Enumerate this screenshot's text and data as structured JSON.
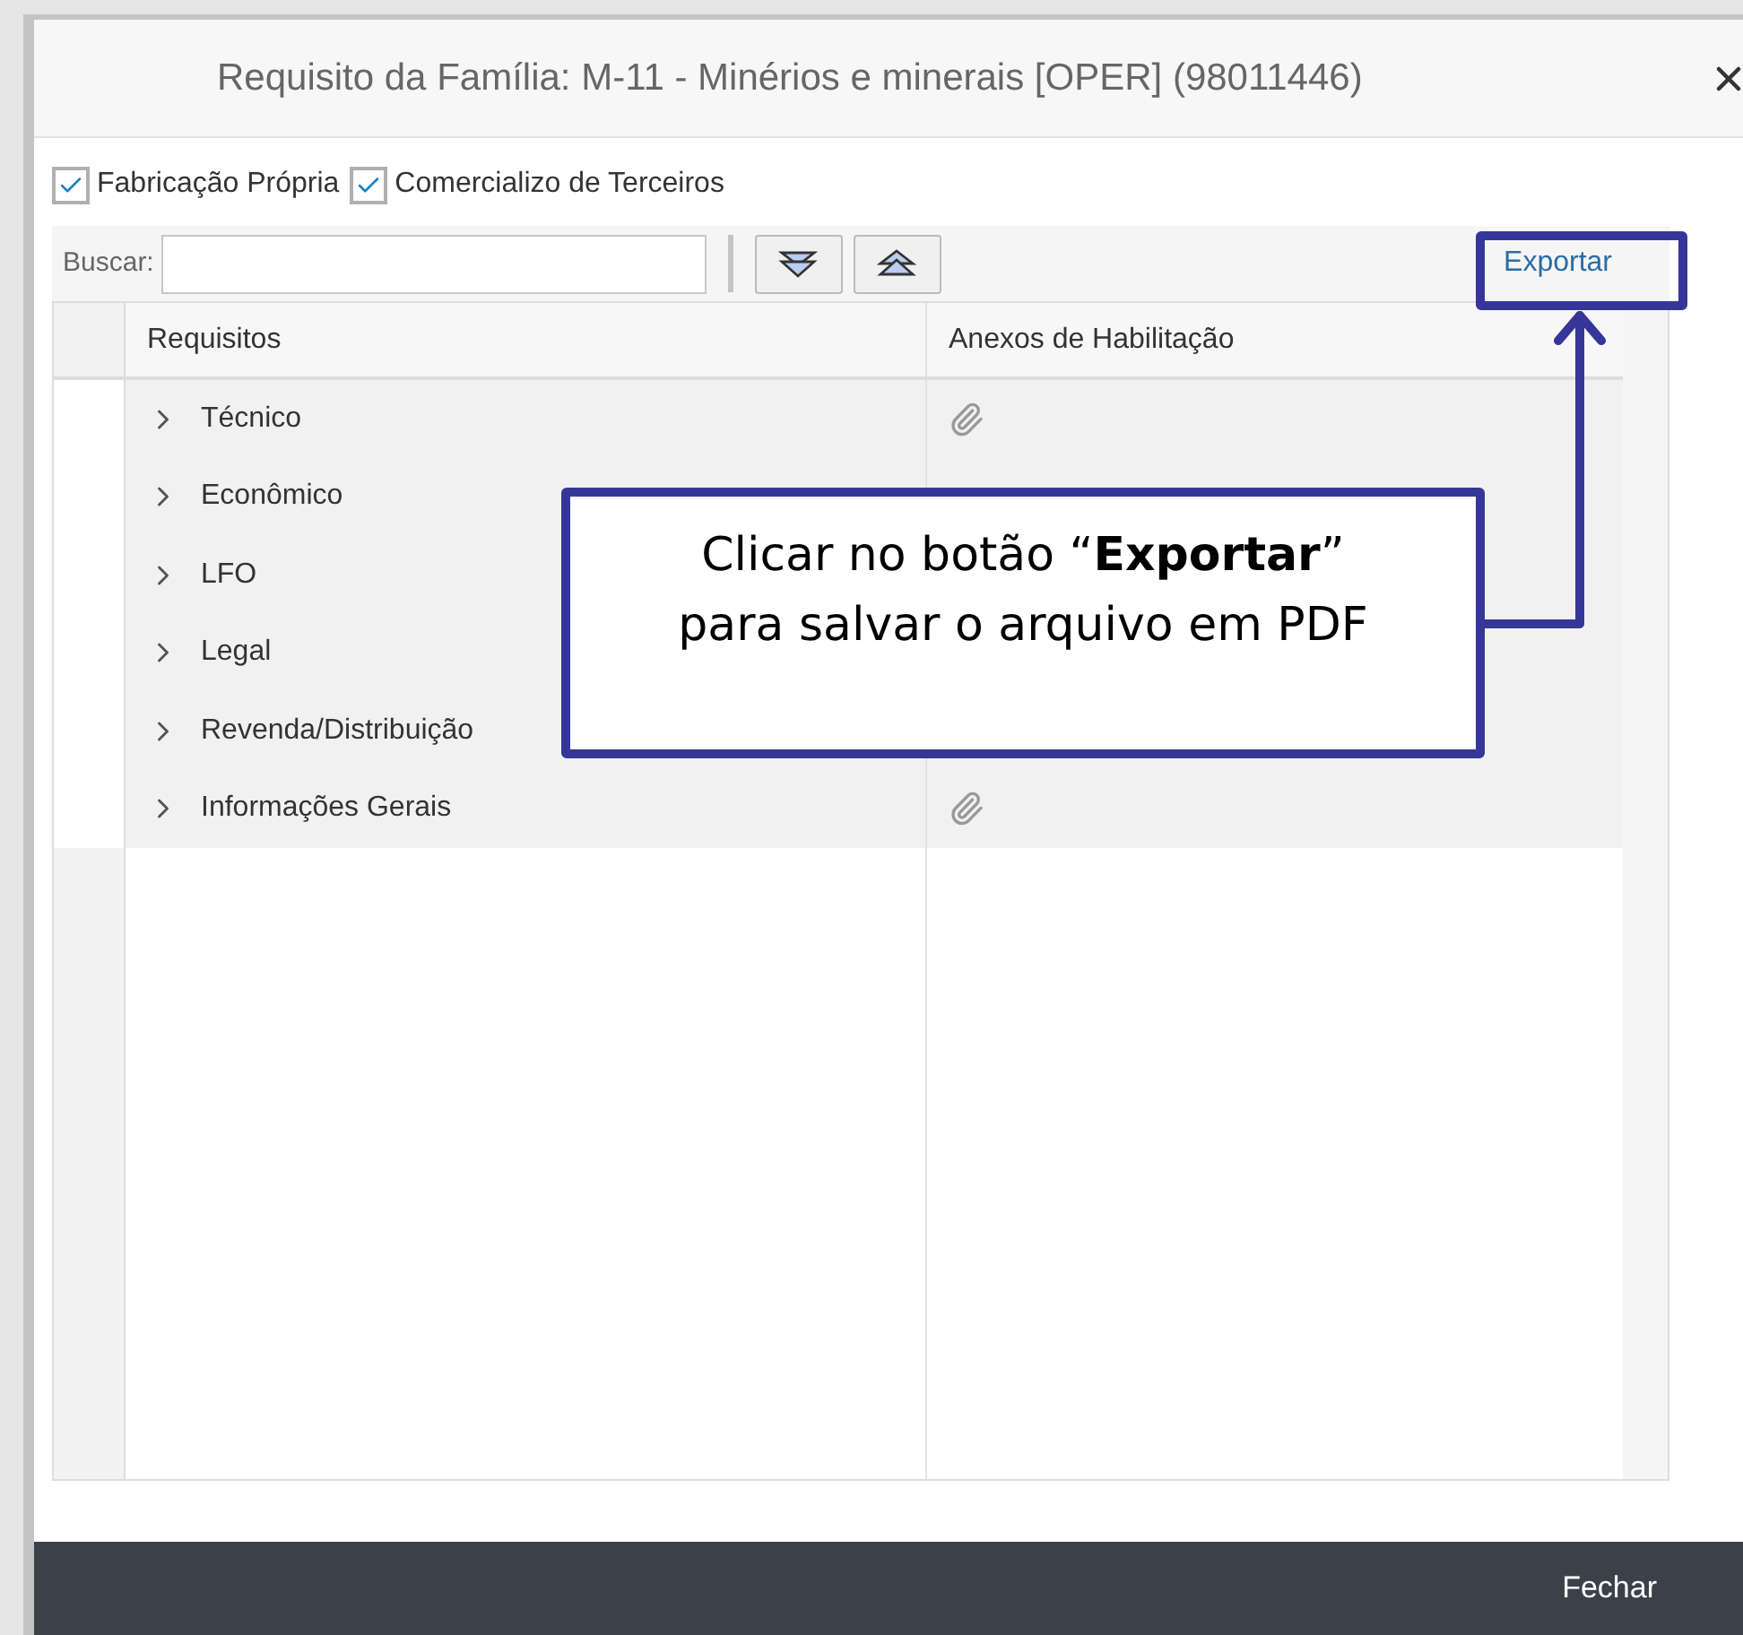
{
  "dialog": {
    "title": "Requisito da Família: M-11 - Minérios e minerais [OPER] (98011446)"
  },
  "filters": [
    {
      "label": "Fabricação Própria",
      "checked": true
    },
    {
      "label": "Comercializo de Terceiros",
      "checked": true
    }
  ],
  "toolbar": {
    "search_label": "Buscar:",
    "export": "Exportar"
  },
  "table": {
    "columns": [
      "Requisitos",
      "Anexos de Habilitação"
    ],
    "rows": [
      {
        "label": "Técnico",
        "expanded": false,
        "attachment": true
      },
      {
        "label": "Econômico",
        "expanded": false
      },
      {
        "label": "LFO",
        "expanded": false
      },
      {
        "label": "Legal",
        "expanded": false
      },
      {
        "label": "Revenda/Distribuição",
        "expanded": false
      },
      {
        "label": "Informações Gerais",
        "expanded": false,
        "attachment": true
      }
    ]
  },
  "callout": {
    "text": "Clicar no botão “**Exportar**”\npara salvar o arquivo em PDF"
  },
  "footer": {
    "close": "Fechar"
  }
}
